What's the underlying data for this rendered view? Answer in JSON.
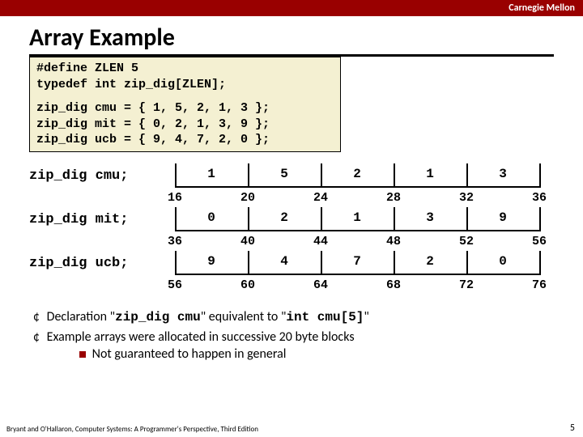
{
  "header": {
    "org": "Carnegie Mellon"
  },
  "title": "Array Example",
  "code": {
    "l1": "#define ZLEN 5",
    "l2": "typedef int zip_dig[ZLEN];",
    "l3": "zip_dig cmu = { 1, 5, 2, 1, 3 };",
    "l4": "zip_dig mit = { 0, 2, 1, 3, 9 };",
    "l5": "zip_dig ucb = { 9, 4, 7, 2, 0 };"
  },
  "arrays": [
    {
      "label": "zip_dig cmu;",
      "values": [
        1,
        5,
        2,
        1,
        3
      ],
      "addrs": [
        16,
        20,
        24,
        28,
        32,
        36
      ]
    },
    {
      "label": "zip_dig mit;",
      "values": [
        0,
        2,
        1,
        3,
        9
      ],
      "addrs": [
        36,
        40,
        44,
        48,
        52,
        56
      ]
    },
    {
      "label": "zip_dig ucb;",
      "values": [
        9,
        4,
        7,
        2,
        0
      ],
      "addrs": [
        56,
        60,
        64,
        68,
        72,
        76
      ]
    }
  ],
  "bullets": {
    "b1a": "Declaration \"",
    "b1b": "zip_dig cmu",
    "b1c": "\" equivalent to \"",
    "b1d": "int cmu[5]",
    "b1e": "\"",
    "b2": "Example arrays were allocated in successive 20 byte blocks",
    "b2s": "Not guaranteed to happen in general"
  },
  "footer": "Bryant and O'Hallaron, Computer Systems: A Programmer's Perspective, Third Edition",
  "page": "5"
}
